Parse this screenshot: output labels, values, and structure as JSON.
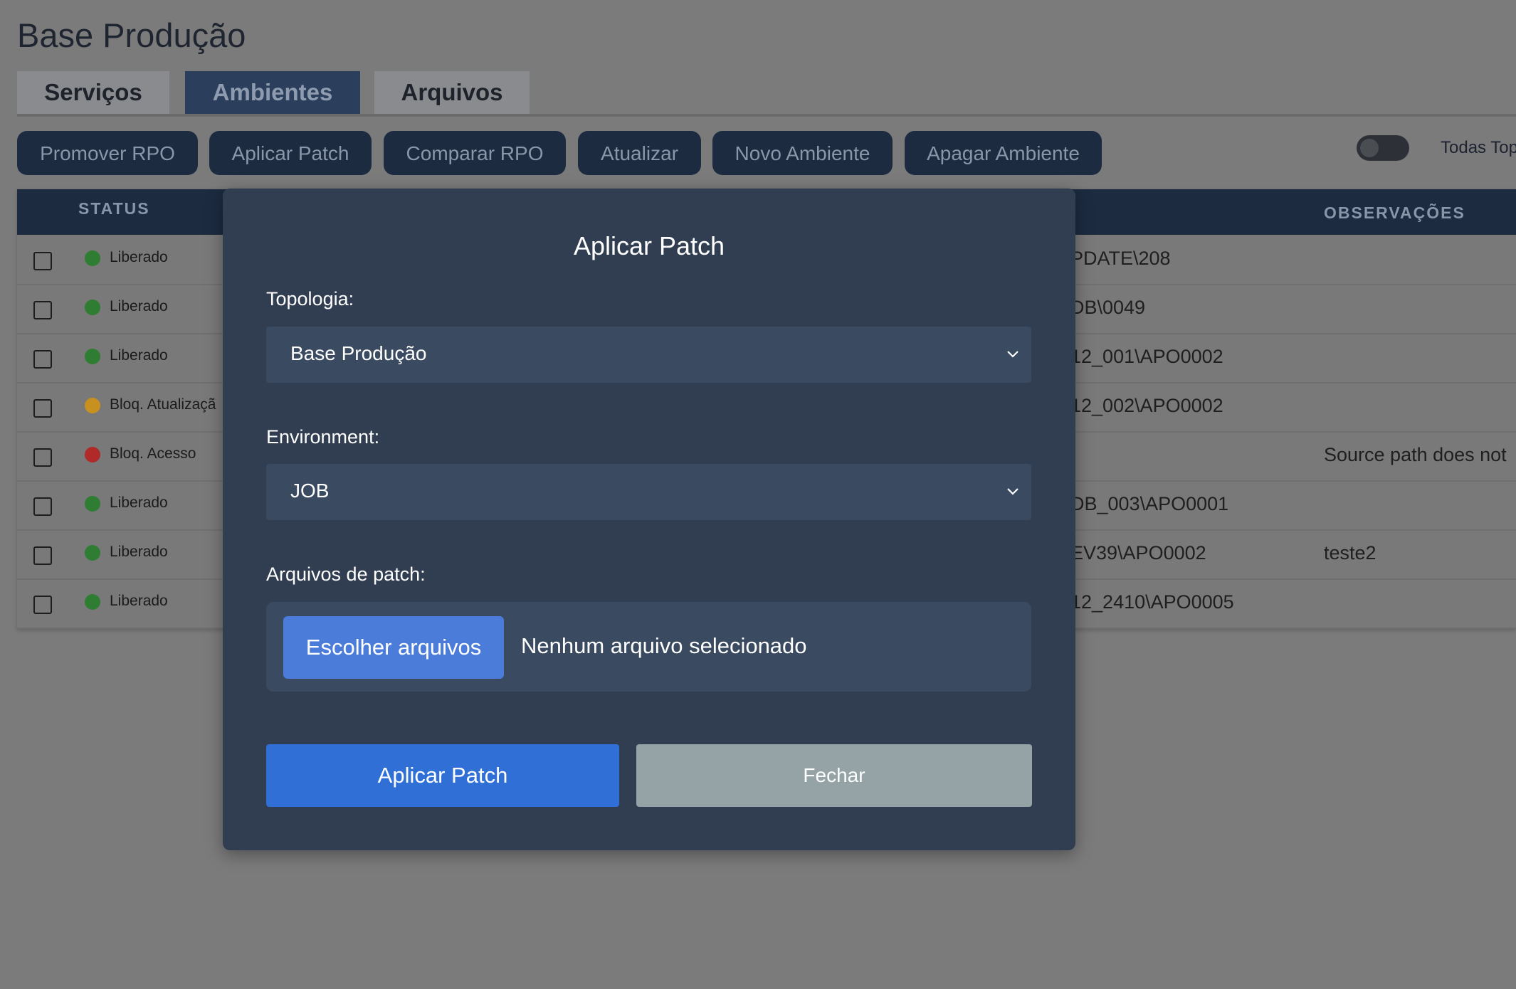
{
  "page": {
    "title": "Base Produção"
  },
  "tabs": [
    {
      "label": "Serviços",
      "active": false
    },
    {
      "label": "Ambientes",
      "active": true
    },
    {
      "label": "Arquivos",
      "active": false
    }
  ],
  "toolbar": {
    "buttons": [
      "Promover RPO",
      "Aplicar Patch",
      "Comparar RPO",
      "Atualizar",
      "Novo Ambiente",
      "Apagar Ambiente"
    ],
    "toggle_label": "Todas Top",
    "toggle_on": false
  },
  "table": {
    "headers": {
      "status": "STATUS",
      "observacoes": "OBSERVAÇÕES"
    },
    "rows": [
      {
        "status": "Liberado",
        "status_color": "#2e7d32",
        "path": "PDATE\\208",
        "obs": ""
      },
      {
        "status": "Liberado",
        "status_color": "#2e7d32",
        "path": "DB\\0049",
        "obs": ""
      },
      {
        "status": "Liberado",
        "status_color": "#2e7d32",
        "path": "12_001\\APO0002",
        "obs": ""
      },
      {
        "status": "Bloq. Atualizaçã",
        "status_color": "#c7901f",
        "path": "12_002\\APO0002",
        "obs": ""
      },
      {
        "status": "Bloq. Acesso",
        "status_color": "#b02a2a",
        "path": "",
        "obs": "Source path does not"
      },
      {
        "status": "Liberado",
        "status_color": "#2e7d32",
        "path": "DB_003\\APO0001",
        "obs": ""
      },
      {
        "status": "Liberado",
        "status_color": "#2e7d32",
        "path": "EV39\\APO0002",
        "obs": "teste2"
      },
      {
        "status": "Liberado",
        "status_color": "#2e7d32",
        "path": "12_2410\\APO0005",
        "obs": ""
      }
    ]
  },
  "modal": {
    "title": "Aplicar Patch",
    "topologia_label": "Topologia:",
    "topologia_value": "Base Produção",
    "environment_label": "Environment:",
    "environment_value": "JOB",
    "files_label": "Arquivos de patch:",
    "file_button": "Escolher arquivos",
    "file_status": "Nenhum arquivo selecionado",
    "apply_button": "Aplicar Patch",
    "close_button": "Fechar"
  }
}
